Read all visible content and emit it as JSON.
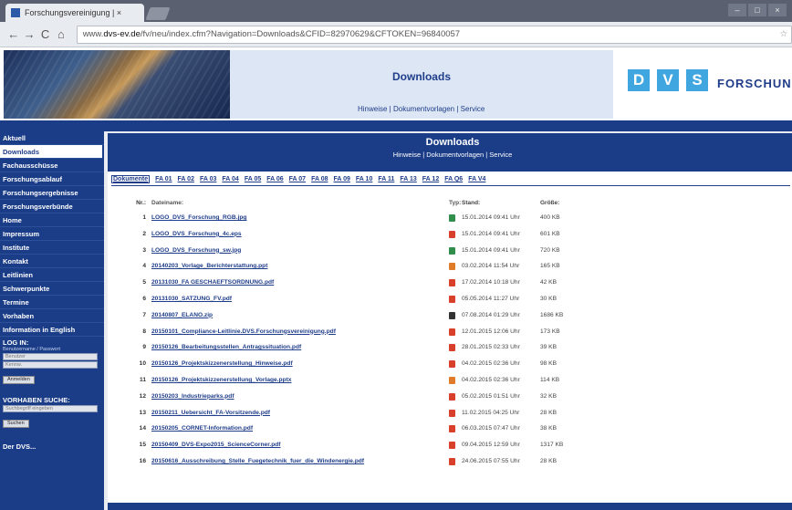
{
  "browser": {
    "tab_title": "Forschungsvereinigung | ×",
    "url_prefix": "www.",
    "url_domain": "dvs-ev.de",
    "url_rest": "/fv/neu/index.cfm?Navigation=Downloads&CFID=82970629&CFTOKEN=96840057",
    "window_controls": [
      "–",
      "□",
      "×"
    ]
  },
  "header": {
    "title": "Downloads",
    "links": "Hinweise | Dokumentvorlagen | Service",
    "logo_letters": [
      "D",
      "V",
      "S"
    ],
    "logo_text": "FORSCHUNG"
  },
  "sidebar": {
    "items": [
      {
        "label": "Aktuell",
        "active": false
      },
      {
        "label": "Downloads",
        "active": true
      },
      {
        "label": "Fachausschüsse",
        "active": false
      },
      {
        "label": "Forschungsablauf",
        "active": false
      },
      {
        "label": "Forschungsergebnisse",
        "active": false
      },
      {
        "label": "Forschungsverbünde",
        "active": false
      },
      {
        "label": "Home",
        "active": false
      },
      {
        "label": "Impressum",
        "active": false
      },
      {
        "label": "Institute",
        "active": false
      },
      {
        "label": "Kontakt",
        "active": false
      },
      {
        "label": "Leitlinien",
        "active": false
      },
      {
        "label": "Schwerpunkte",
        "active": false
      },
      {
        "label": "Termine",
        "active": false
      },
      {
        "label": "Vorhaben",
        "active": false
      },
      {
        "label": "Information in English",
        "active": false
      }
    ],
    "login": {
      "title": "LOG IN:",
      "hint": "Benutzername / Passwort",
      "user_placeholder": "Benutzer",
      "pass_placeholder": "Kennw.",
      "button": "Anmelden"
    },
    "search": {
      "title": "VORHABEN SUCHE:",
      "placeholder": "Suchbegriff eingeben",
      "button": "Suchen"
    },
    "footer_item": "Der DVS..."
  },
  "content": {
    "title": "Downloads",
    "links": "Hinweise | Dokumentvorlagen | Service",
    "tabs": [
      "Dokumente",
      "FA 01",
      "FA 02",
      "FA 03",
      "FA 04",
      "FA 05",
      "FA 06",
      "FA 07",
      "FA 08",
      "FA 09",
      "FA 10",
      "FA 11",
      "FA 13",
      "FA 12",
      "FA Q6",
      "FA V4"
    ],
    "columns": {
      "nr": "Nr.:",
      "name": "Dateiname:",
      "type": "Typ:",
      "stand": "Stand:",
      "size": "Größe:"
    },
    "files": [
      {
        "nr": "1",
        "name": "LOGO_DVS_Forschung_RGB.jpg",
        "type": "img",
        "stand": "15.01.2014 09:41 Uhr",
        "size": "400 KB"
      },
      {
        "nr": "2",
        "name": "LOGO_DVS_Forschung_4c.eps",
        "type": "eps",
        "stand": "15.01.2014 09:41 Uhr",
        "size": "601 KB"
      },
      {
        "nr": "3",
        "name": "LOGO_DVS_Forschung_sw.jpg",
        "type": "img",
        "stand": "15.01.2014 09:41 Uhr",
        "size": "720 KB"
      },
      {
        "nr": "4",
        "name": "20140203_Vorlage_Berichterstattung.ppt",
        "type": "ppt",
        "stand": "03.02.2014 11:54 Uhr",
        "size": "165 KB"
      },
      {
        "nr": "5",
        "name": "20131030_FA GESCHAEFTSORDNUNG.pdf",
        "type": "pdf",
        "stand": "17.02.2014 10:18 Uhr",
        "size": "42 KB"
      },
      {
        "nr": "6",
        "name": "20131030_SATZUNG_FV.pdf",
        "type": "pdf",
        "stand": "05.05.2014 11:27 Uhr",
        "size": "30 KB"
      },
      {
        "nr": "7",
        "name": "20140807_ELANO.zip",
        "type": "zip",
        "stand": "07.08.2014 01:29 Uhr",
        "size": "1686 KB"
      },
      {
        "nr": "8",
        "name": "20150101_Compliance-Leitlinie.DVS.Forschungsvereinigung.pdf",
        "type": "pdf",
        "stand": "12.01.2015 12:06 Uhr",
        "size": "173 KB"
      },
      {
        "nr": "9",
        "name": "20150126_Bearbeitungsstellen_Antragssituation.pdf",
        "type": "pdf",
        "stand": "28.01.2015 02:33 Uhr",
        "size": "39 KB"
      },
      {
        "nr": "10",
        "name": "20150126_Projektskizzenerstellung_Hinweise.pdf",
        "type": "pdf",
        "stand": "04.02.2015 02:36 Uhr",
        "size": "98 KB"
      },
      {
        "nr": "11",
        "name": "20150126_Projektskizzenerstellung_Vorlage.pptx",
        "type": "ppt",
        "stand": "04.02.2015 02:36 Uhr",
        "size": "114 KB"
      },
      {
        "nr": "12",
        "name": "20150203_Industrieparks.pdf",
        "type": "pdf",
        "stand": "05.02.2015 01:51 Uhr",
        "size": "32 KB"
      },
      {
        "nr": "13",
        "name": "20150211_Uebersicht_FA-Vorsitzende.pdf",
        "type": "pdf",
        "stand": "11.02.2015 04:25 Uhr",
        "size": "28 KB"
      },
      {
        "nr": "14",
        "name": "20150205_CORNET-Information.pdf",
        "type": "pdf",
        "stand": "06.03.2015 07:47 Uhr",
        "size": "38 KB"
      },
      {
        "nr": "15",
        "name": "20150409_DVS-Expo2015_ScienceCorner.pdf",
        "type": "pdf",
        "stand": "09.04.2015 12:59 Uhr",
        "size": "1317 KB"
      },
      {
        "nr": "16",
        "name": "20150616_Ausschreibung_Stelle_Fuegetechnik_fuer_die_Windenergie.pdf",
        "type": "pdf",
        "stand": "24.06.2015 07:55 Uhr",
        "size": "28 KB"
      }
    ]
  },
  "colors": {
    "brand_blue": "#1b3d88",
    "logo_cyan": "#3fa6e0",
    "pdf_red": "#d9402b",
    "img_green": "#2f8f4a",
    "ppt_orange": "#e07b2a"
  }
}
